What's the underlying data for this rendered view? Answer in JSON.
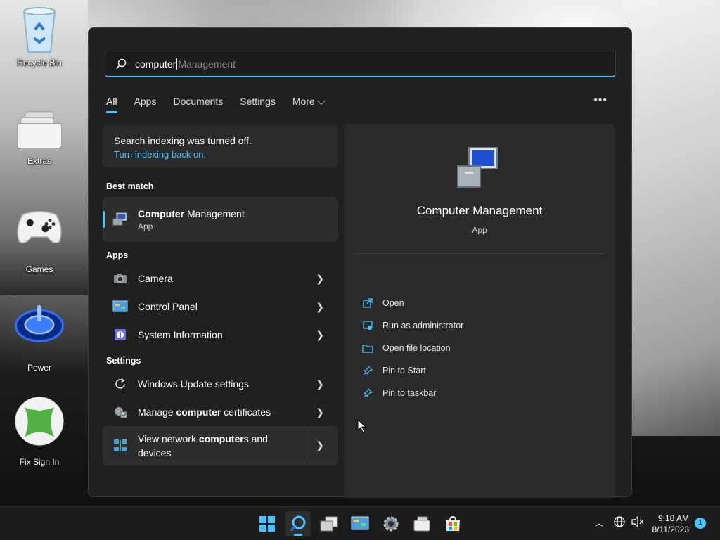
{
  "desktop": {
    "icons": [
      {
        "label": "Recycle Bin"
      },
      {
        "label": "Extras"
      },
      {
        "label": "Games"
      },
      {
        "label": "Power"
      },
      {
        "label": "Fix Sign In"
      }
    ]
  },
  "search": {
    "typed": "computer",
    "suggestion": " Management"
  },
  "tabs": [
    "All",
    "Apps",
    "Documents",
    "Settings",
    "More ⌵"
  ],
  "notice": {
    "line1": "Search indexing was turned off.",
    "link": "Turn indexing back on."
  },
  "best_match": {
    "heading": "Best match",
    "name_bold": "Computer",
    "name_rest": " Management",
    "type": "App"
  },
  "apps_section": {
    "heading": "Apps",
    "items": [
      "Camera",
      "Control Panel",
      "System Information"
    ]
  },
  "settings_section": {
    "heading": "Settings",
    "items": [
      {
        "pre": "Windows Update settings",
        "bold": "",
        "post": ""
      },
      {
        "pre": "Manage ",
        "bold": "computer",
        "post": " certificates"
      },
      {
        "pre": "View network ",
        "bold": "computer",
        "post": "s and devices"
      }
    ]
  },
  "detail": {
    "title": "Computer Management",
    "subtitle": "App",
    "actions": [
      "Open",
      "Run as administrator",
      "Open file location",
      "Pin to Start",
      "Pin to taskbar"
    ]
  },
  "taskbar": {
    "time": "9:18 AM",
    "date": "8/11/2023",
    "notification_count": "1"
  },
  "colors": {
    "accent": "#4cc2ff",
    "panel_bg": "#202020"
  }
}
